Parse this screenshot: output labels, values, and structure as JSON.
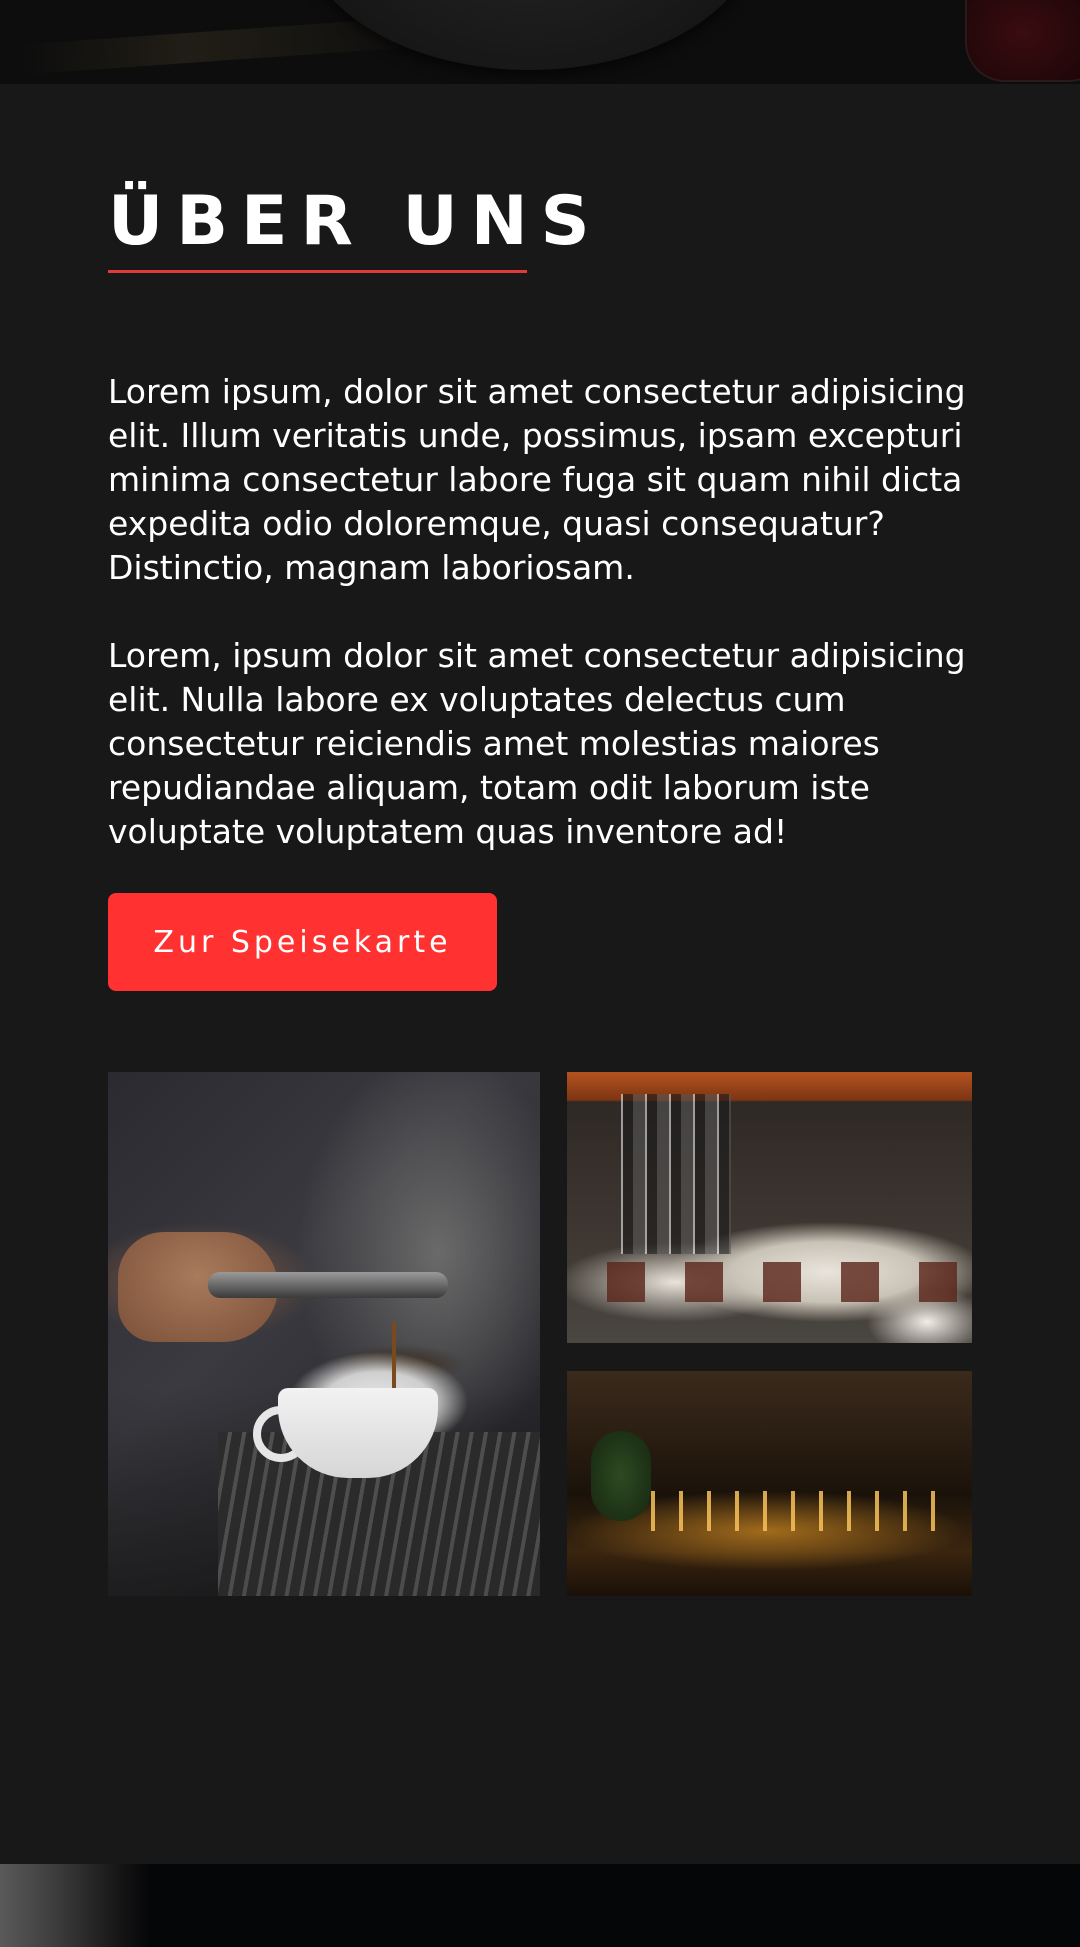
{
  "about": {
    "title": "ÜBER UNS",
    "paragraphs": [
      "Lorem ipsum, dolor sit amet consectetur adipisicing elit. Illum veritatis unde, possimus, ipsam excepturi minima consectetur labore fuga sit quam nihil dicta expedita odio doloremque, quasi consequatur? Distinctio, magnam laboriosam.",
      "Lorem, ipsum dolor sit amet consectetur adipisicing elit. Nulla labore ex voluptates delectus cum consectetur reiciendis amet molestias maiores repudiandae aliquam, totam odit laborum iste voluptate voluptatem quas inventore ad!"
    ],
    "button_label": "Zur Speisekarte"
  },
  "gallery": {
    "images": [
      {
        "subject": "espresso-machine"
      },
      {
        "subject": "restaurant-dining-room"
      },
      {
        "subject": "restaurant-bar"
      }
    ]
  },
  "colors": {
    "background": "#181818",
    "accent": "#ff3131",
    "underline": "#e03a3a",
    "text": "#ffffff"
  }
}
